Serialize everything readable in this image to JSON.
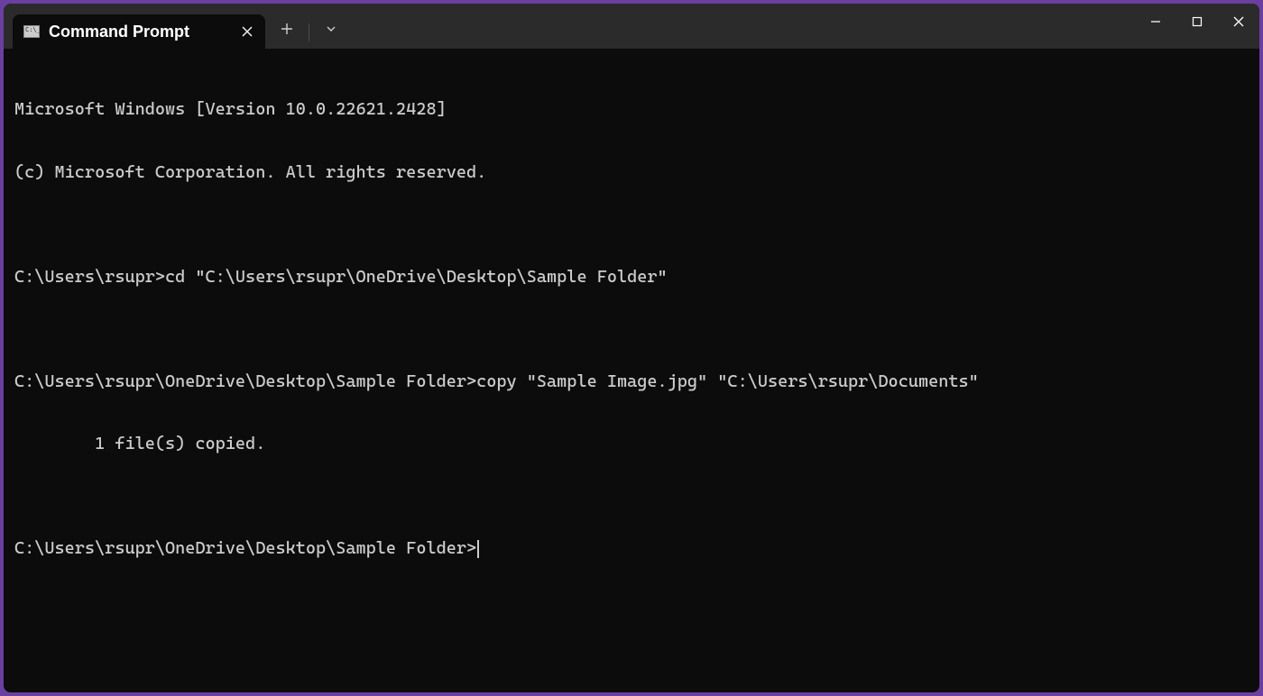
{
  "tab": {
    "title": "Command Prompt"
  },
  "terminal": {
    "lines": [
      "Microsoft Windows [Version 10.0.22621.2428]",
      "(c) Microsoft Corporation. All rights reserved.",
      "",
      "C:\\Users\\rsupr>cd \"C:\\Users\\rsupr\\OneDrive\\Desktop\\Sample Folder\"",
      "",
      "C:\\Users\\rsupr\\OneDrive\\Desktop\\Sample Folder>copy \"Sample Image.jpg\" \"C:\\Users\\rsupr\\Documents\"",
      "        1 file(s) copied.",
      "",
      "C:\\Users\\rsupr\\OneDrive\\Desktop\\Sample Folder>"
    ]
  }
}
